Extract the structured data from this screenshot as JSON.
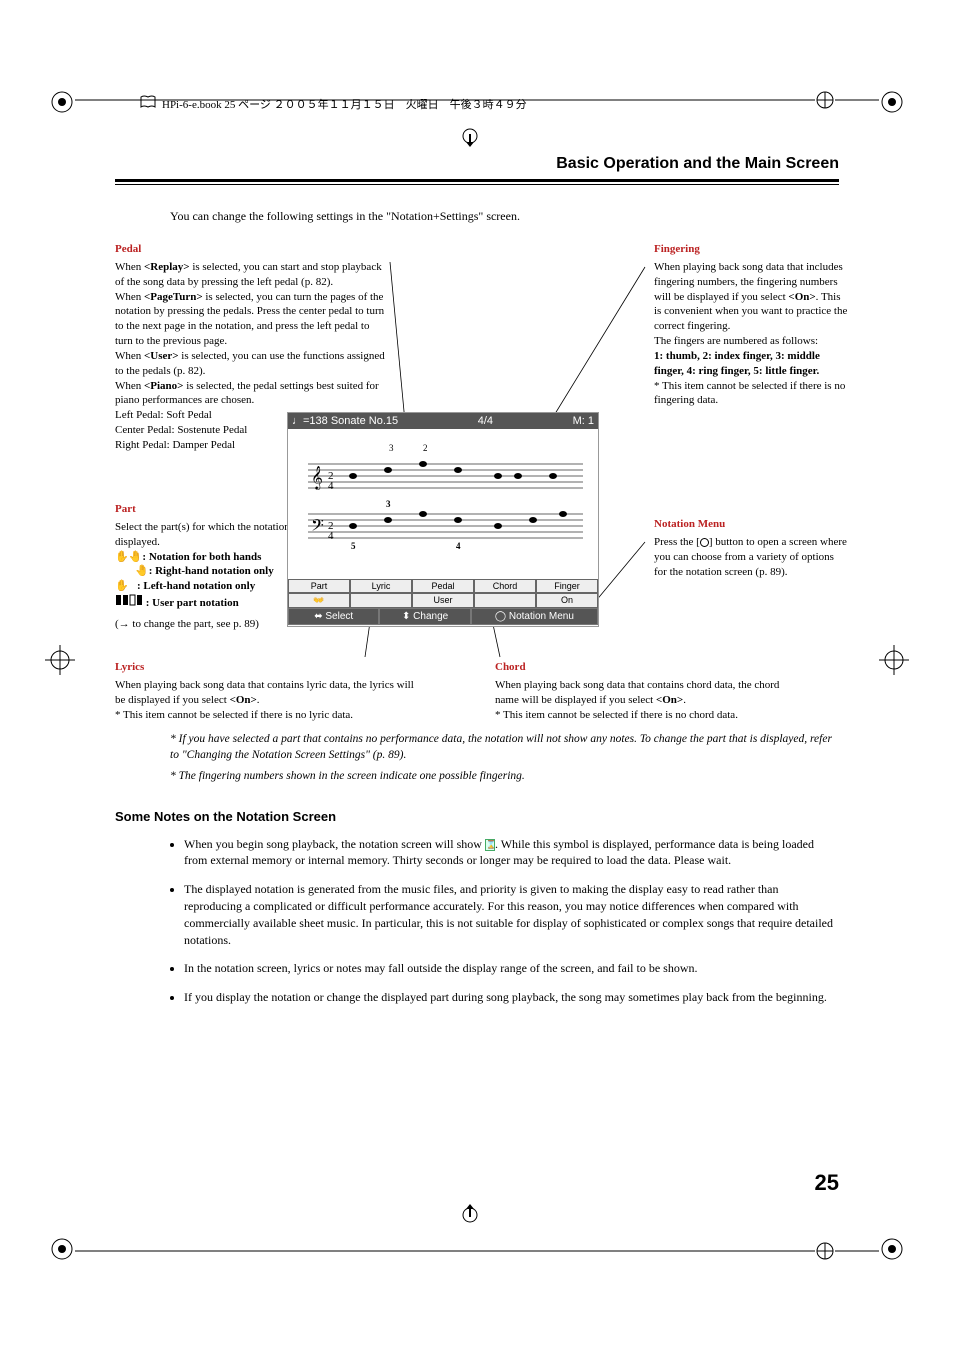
{
  "book_header": "HPi-6-e.book 25 ページ ２００５年１１月１５日　火曜日　午後３時４９分",
  "page_title": "Basic Operation and the Main Screen",
  "intro": "You can change the following settings in the \"Notation+Settings\" screen.",
  "pedal": {
    "title": "Pedal",
    "l1a": "When ",
    "l1b": "<Replay>",
    "l1c": " is selected, you can start and stop playback of the song data by pressing the left pedal (p. 82).",
    "l2a": "When ",
    "l2b": "<PageTurn>",
    "l2c": " is selected, you can turn the pages of the notation by pressing the pedals. Press the center pedal to turn to the next page in the notation, and press the left pedal to turn to the previous page.",
    "l3a": "When ",
    "l3b": "<User>",
    "l3c": " is selected, you can use the functions assigned to the pedals (p. 82).",
    "l4a": "When ",
    "l4b": "<Piano>",
    "l4c": " is selected, the pedal settings best suited for piano performances are chosen.",
    "l5": "Left Pedal: Soft Pedal",
    "l6": "Center Pedal: Sostenute Pedal",
    "l7": "Right Pedal: Damper Pedal"
  },
  "fingering": {
    "title": "Fingering",
    "p1a": "When playing back song data that includes fingering numbers, the fingering numbers will be displayed if you select ",
    "p1b": "<On>",
    "p1c": ". This is convenient when you want to practice the correct fingering.",
    "p2": "The fingers are numbered as follows:",
    "p3": "1: thumb, 2: index finger, 3: middle finger, 4: ring finger, 5: little finger.",
    "p4": "* This item cannot be selected if there is no fingering data."
  },
  "part": {
    "title": "Part",
    "p1": "Select the part(s) for which the notation will be displayed.",
    "opt1": ": Notation for both hands",
    "opt2": ": Right-hand notation only",
    "opt3": ": Left-hand notation only",
    "opt4": ": User part notation",
    "p2": "(→ to change the part, see p. 89)"
  },
  "notation_menu": {
    "title": "Notation Menu",
    "p1a": "Press the [",
    "p1b": "] button to open a screen where you can choose from a variety of options for the notation screen (p. 89)."
  },
  "lyrics": {
    "title": "Lyrics",
    "p1a": "When playing back song data that contains lyric data, the lyrics will be displayed if you select ",
    "p1b": "<On>",
    "p1c": ".",
    "p2": "* This item cannot be selected if there is no lyric data."
  },
  "chord": {
    "title": "Chord",
    "p1a": "When playing back song data that contains chord data, the chord name will be displayed if you select ",
    "p1b": "<On>",
    "p1c": ".",
    "p2": "* This item cannot be selected if there is no chord data."
  },
  "screen": {
    "header_left": "♩=138 Sonate No.15",
    "header_mid": "4/4",
    "header_right": "M:    1",
    "tabs": [
      "Part",
      "Lyric",
      "Pedal",
      "Chord",
      "Finger"
    ],
    "vals": [
      "👐",
      "",
      "User",
      "",
      "On"
    ],
    "bottom": [
      "⬌ Select",
      "⬍ Change",
      "◯ Notation Menu"
    ]
  },
  "footnote1": "* If you have selected a part that contains no performance data, the notation will not show any notes. To change the part that is displayed, refer to \"Changing the Notation Screen Settings\" (p. 89).",
  "footnote2": "* The fingering numbers shown in the screen indicate one possible fingering.",
  "subhead": "Some Notes on the Notation Screen",
  "bullets": {
    "b1a": "When you begin song playback, the notation screen will show ",
    "b1b": ". While this symbol is displayed, performance data is being loaded from external memory or internal memory. Thirty seconds or longer may be required to load the data. Please wait.",
    "b2": "The displayed notation is generated from the music files, and priority is given to making the display easy to read rather than reproducing a complicated or difficult performance accurately. For this reason, you may notice differences when compared with commercially available sheet music. In particular, this is not suitable for display of sophisticated or complex songs that require detailed notations.",
    "b3": "In the notation screen, lyrics or notes may fall outside the display range of the screen, and fail to be shown.",
    "b4": "If you display the notation or change the displayed part during song playback, the song may sometimes play back from the beginning."
  },
  "page_num": "25"
}
